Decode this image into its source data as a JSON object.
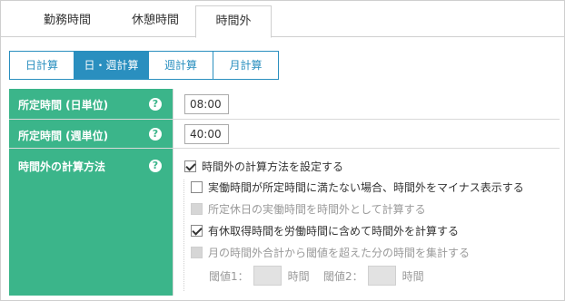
{
  "tabs": [
    {
      "label": "勤務時間",
      "active": false
    },
    {
      "label": "休憩時間",
      "active": false
    },
    {
      "label": "時間外",
      "active": true
    }
  ],
  "subtabs": [
    {
      "label": "日計算",
      "active": false
    },
    {
      "label": "日・週計算",
      "active": true
    },
    {
      "label": "週計算",
      "active": false
    },
    {
      "label": "月計算",
      "active": false
    }
  ],
  "settings": {
    "daily": {
      "label": "所定時間 (日単位)",
      "value": "08:00"
    },
    "weekly": {
      "label": "所定時間 (週単位)",
      "value": "40:00"
    },
    "overtime": {
      "label": "時間外の計算方法",
      "main_option": {
        "label": "時間外の計算方法を設定する",
        "checked": true
      },
      "options": [
        {
          "label": "実働時間が所定時間に満たない場合、時間外をマイナス表示する",
          "checked": false,
          "disabled": false
        },
        {
          "label": "所定休日の実働時間を時間外として計算する",
          "checked": false,
          "disabled": true
        },
        {
          "label": "有休取得時間を労働時間に含めて時間外を計算する",
          "checked": true,
          "disabled": false
        },
        {
          "label": "月の時間外合計から閾値を超えた分の時間を集計する",
          "checked": false,
          "disabled": true
        }
      ],
      "threshold1": {
        "label": "閾値1：",
        "unit": "時間"
      },
      "threshold2": {
        "label": "閾値2：",
        "unit": "時間"
      }
    }
  },
  "help_glyph": "?",
  "colors": {
    "label_bg": "#3bb58a",
    "accent": "#2a8fbf"
  }
}
